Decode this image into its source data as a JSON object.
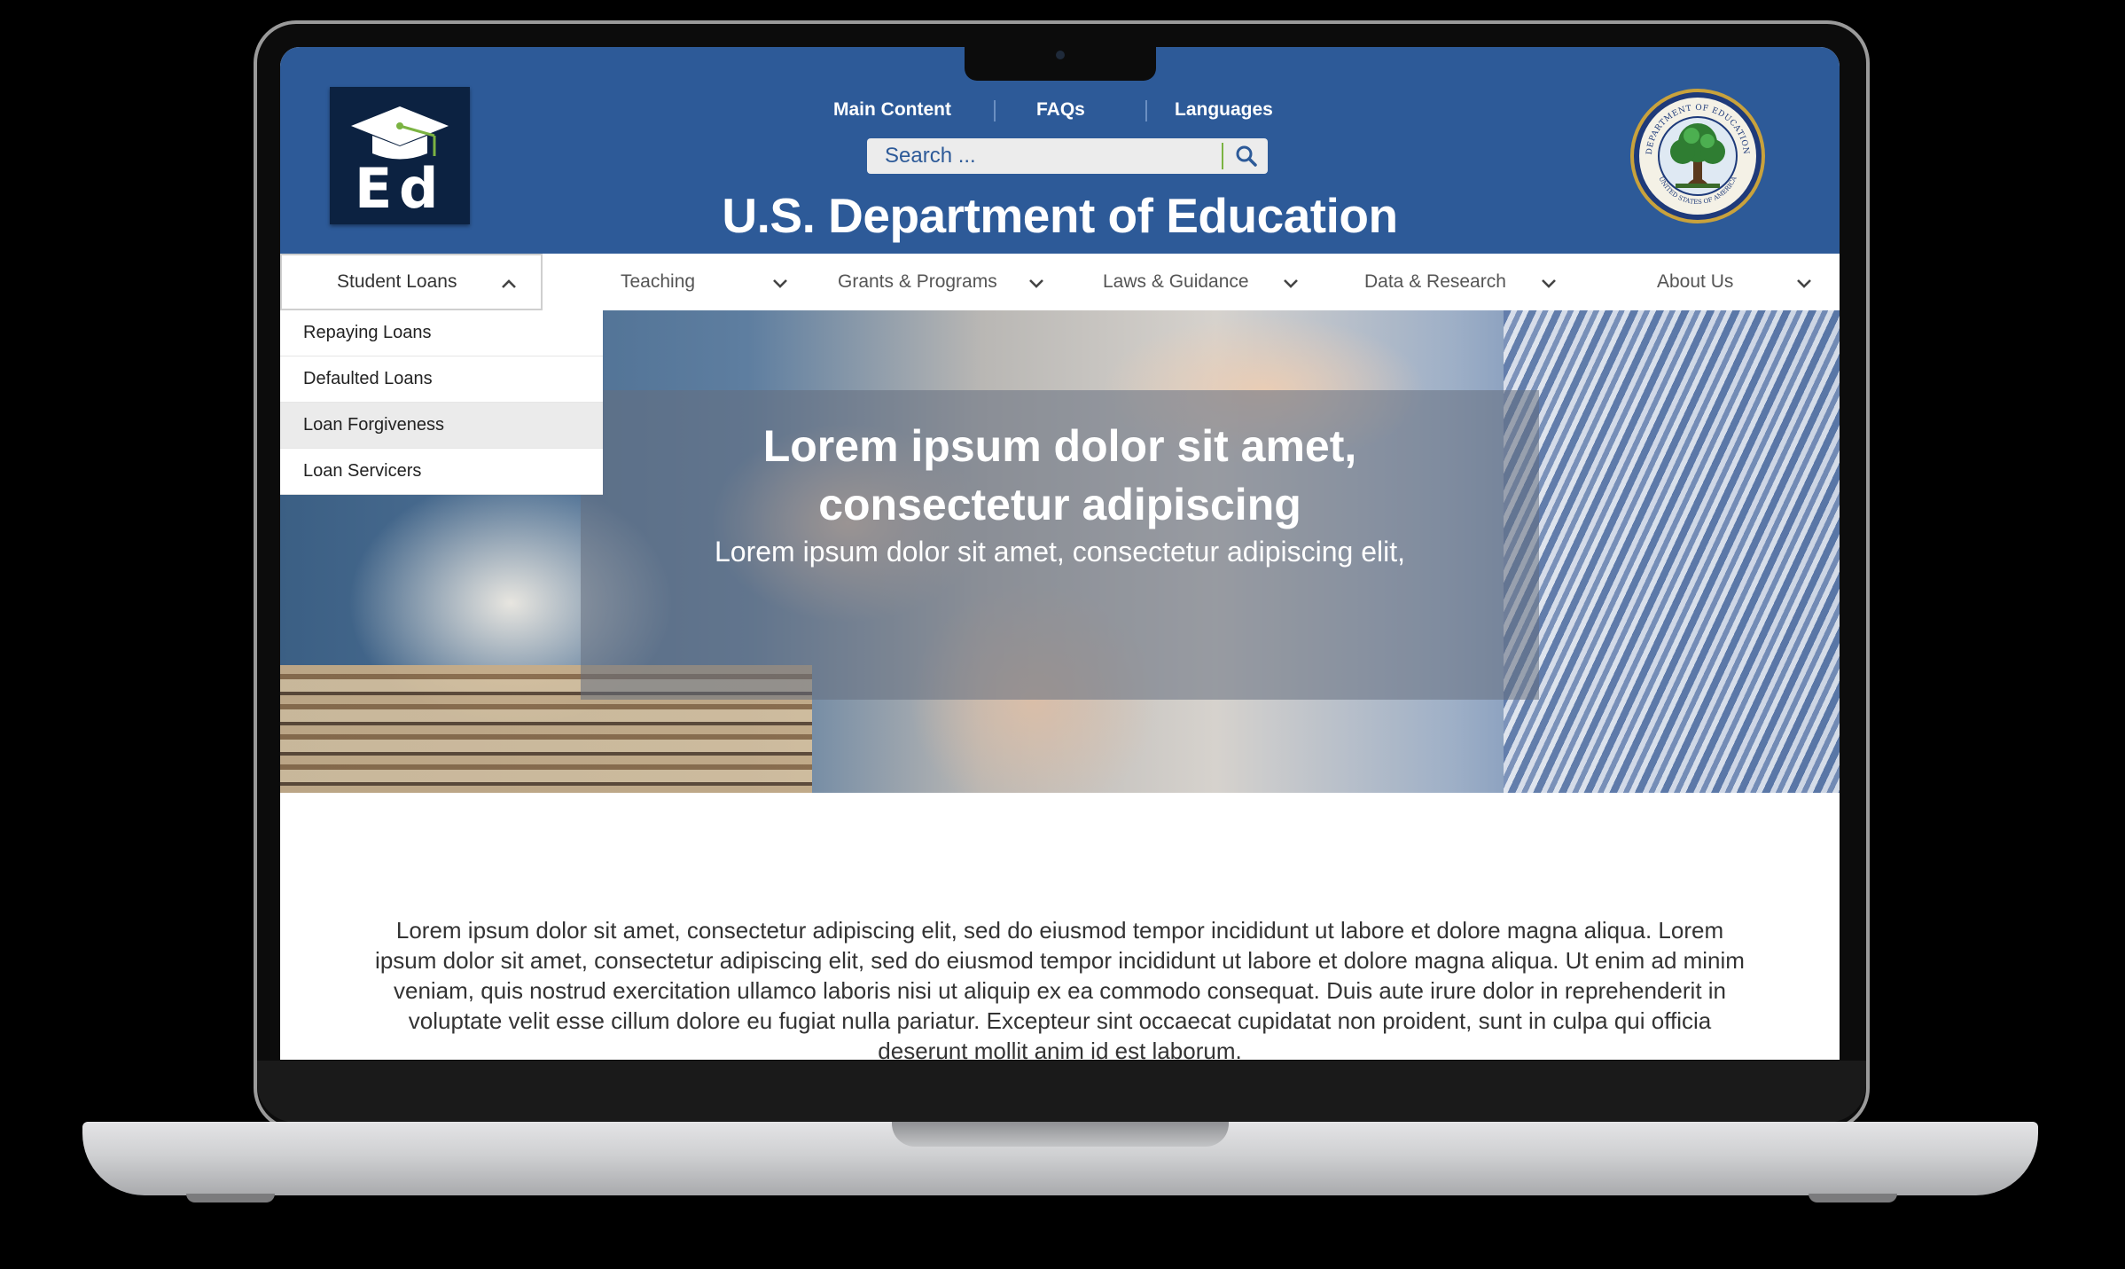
{
  "header": {
    "top_links": [
      "Main Content",
      "FAQs",
      "Languages"
    ],
    "search_placeholder": "Search ...",
    "site_title": "U.S. Department of Education",
    "logo_icon": "ed-graduation-cap-logo",
    "seal_icon": "department-of-education-seal",
    "seal_text_top": "DEPARTMENT OF EDUCATION",
    "seal_text_bottom": "UNITED STATES OF AMERICA"
  },
  "nav": {
    "items": [
      {
        "label": "Student Loans",
        "expanded": true
      },
      {
        "label": "Teaching",
        "expanded": false
      },
      {
        "label": "Grants & Programs",
        "expanded": false
      },
      {
        "label": "Laws & Guidance",
        "expanded": false
      },
      {
        "label": "Data & Research",
        "expanded": false
      },
      {
        "label": "About Us",
        "expanded": false
      }
    ]
  },
  "dropdown": {
    "items": [
      {
        "label": "Repaying Loans",
        "hovered": false
      },
      {
        "label": "Defaulted Loans",
        "hovered": false
      },
      {
        "label": "Loan Forgiveness",
        "hovered": true
      },
      {
        "label": "Loan Servicers",
        "hovered": false
      }
    ]
  },
  "hero": {
    "title": "Lorem ipsum dolor sit amet, consectetur adipiscing",
    "subtitle": "Lorem ipsum dolor sit amet, consectetur adipiscing elit,"
  },
  "main": {
    "body": "Lorem ipsum dolor sit amet, consectetur adipiscing elit, sed do eiusmod tempor incididunt ut labore et dolore magna aliqua. Lorem ipsum dolor sit amet, consectetur adipiscing elit, sed do eiusmod tempor incididunt ut labore et dolore magna aliqua. Ut enim ad minim veniam, quis nostrud exercitation ullamco laboris nisi ut aliquip ex ea commodo consequat. Duis aute irure dolor in reprehenderit in voluptate velit esse cillum dolore eu fugiat nulla pariatur. Excepteur sint occaecat cupidatat non proident, sunt in culpa qui officia deserunt mollit anim id est laborum."
  },
  "colors": {
    "header_blue": "#2d5a98",
    "logo_navy": "#0c2241",
    "accent_green": "#7bb342"
  }
}
